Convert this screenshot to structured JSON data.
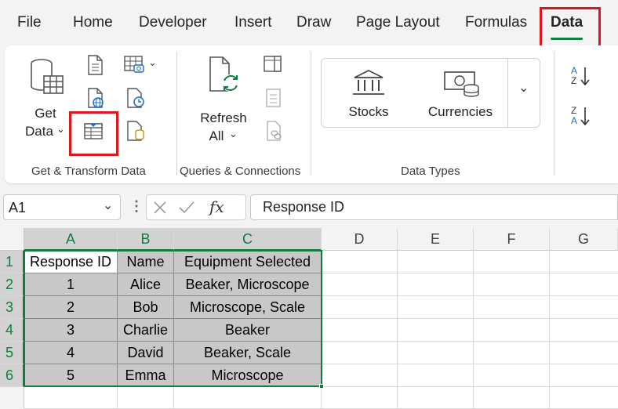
{
  "tabs": [
    {
      "label": "File"
    },
    {
      "label": "Home"
    },
    {
      "label": "Developer"
    },
    {
      "label": "Insert"
    },
    {
      "label": "Draw"
    },
    {
      "label": "Page Layout"
    },
    {
      "label": "Formulas"
    },
    {
      "label": "Data",
      "active": true
    }
  ],
  "ribbon": {
    "get_data_line1": "Get",
    "get_data_line2": "Data",
    "refresh_line1": "Refresh",
    "refresh_line2": "All",
    "stocks": "Stocks",
    "currencies": "Currencies",
    "sort_az": "A Z",
    "sort_za": "Z A",
    "groups": {
      "get_transform": "Get & Transform Data",
      "queries": "Queries & Connections",
      "data_types": "Data Types"
    },
    "highlighted_button": "from-table-range-icon"
  },
  "formula_bar": {
    "name_box": "A1",
    "value": "Response ID",
    "fx": "fx"
  },
  "sheet": {
    "columns": [
      "A",
      "B",
      "C",
      "D",
      "E",
      "F",
      "G"
    ],
    "rows": [
      "1",
      "2",
      "3",
      "4",
      "5",
      "6"
    ],
    "data": [
      [
        "Response ID",
        "Name",
        "Equipment Selected"
      ],
      [
        "1",
        "Alice",
        "Beaker, Microscope"
      ],
      [
        "2",
        "Bob",
        "Microscope, Scale"
      ],
      [
        "3",
        "Charlie",
        "Beaker"
      ],
      [
        "4",
        "David",
        "Beaker, Scale"
      ],
      [
        "5",
        "Emma",
        "Microscope"
      ]
    ],
    "selection": "A1:C6"
  },
  "colors": {
    "accent_green": "#107c41",
    "highlight_red": "#e0161e",
    "selection_fill": "#c8c8c8"
  }
}
